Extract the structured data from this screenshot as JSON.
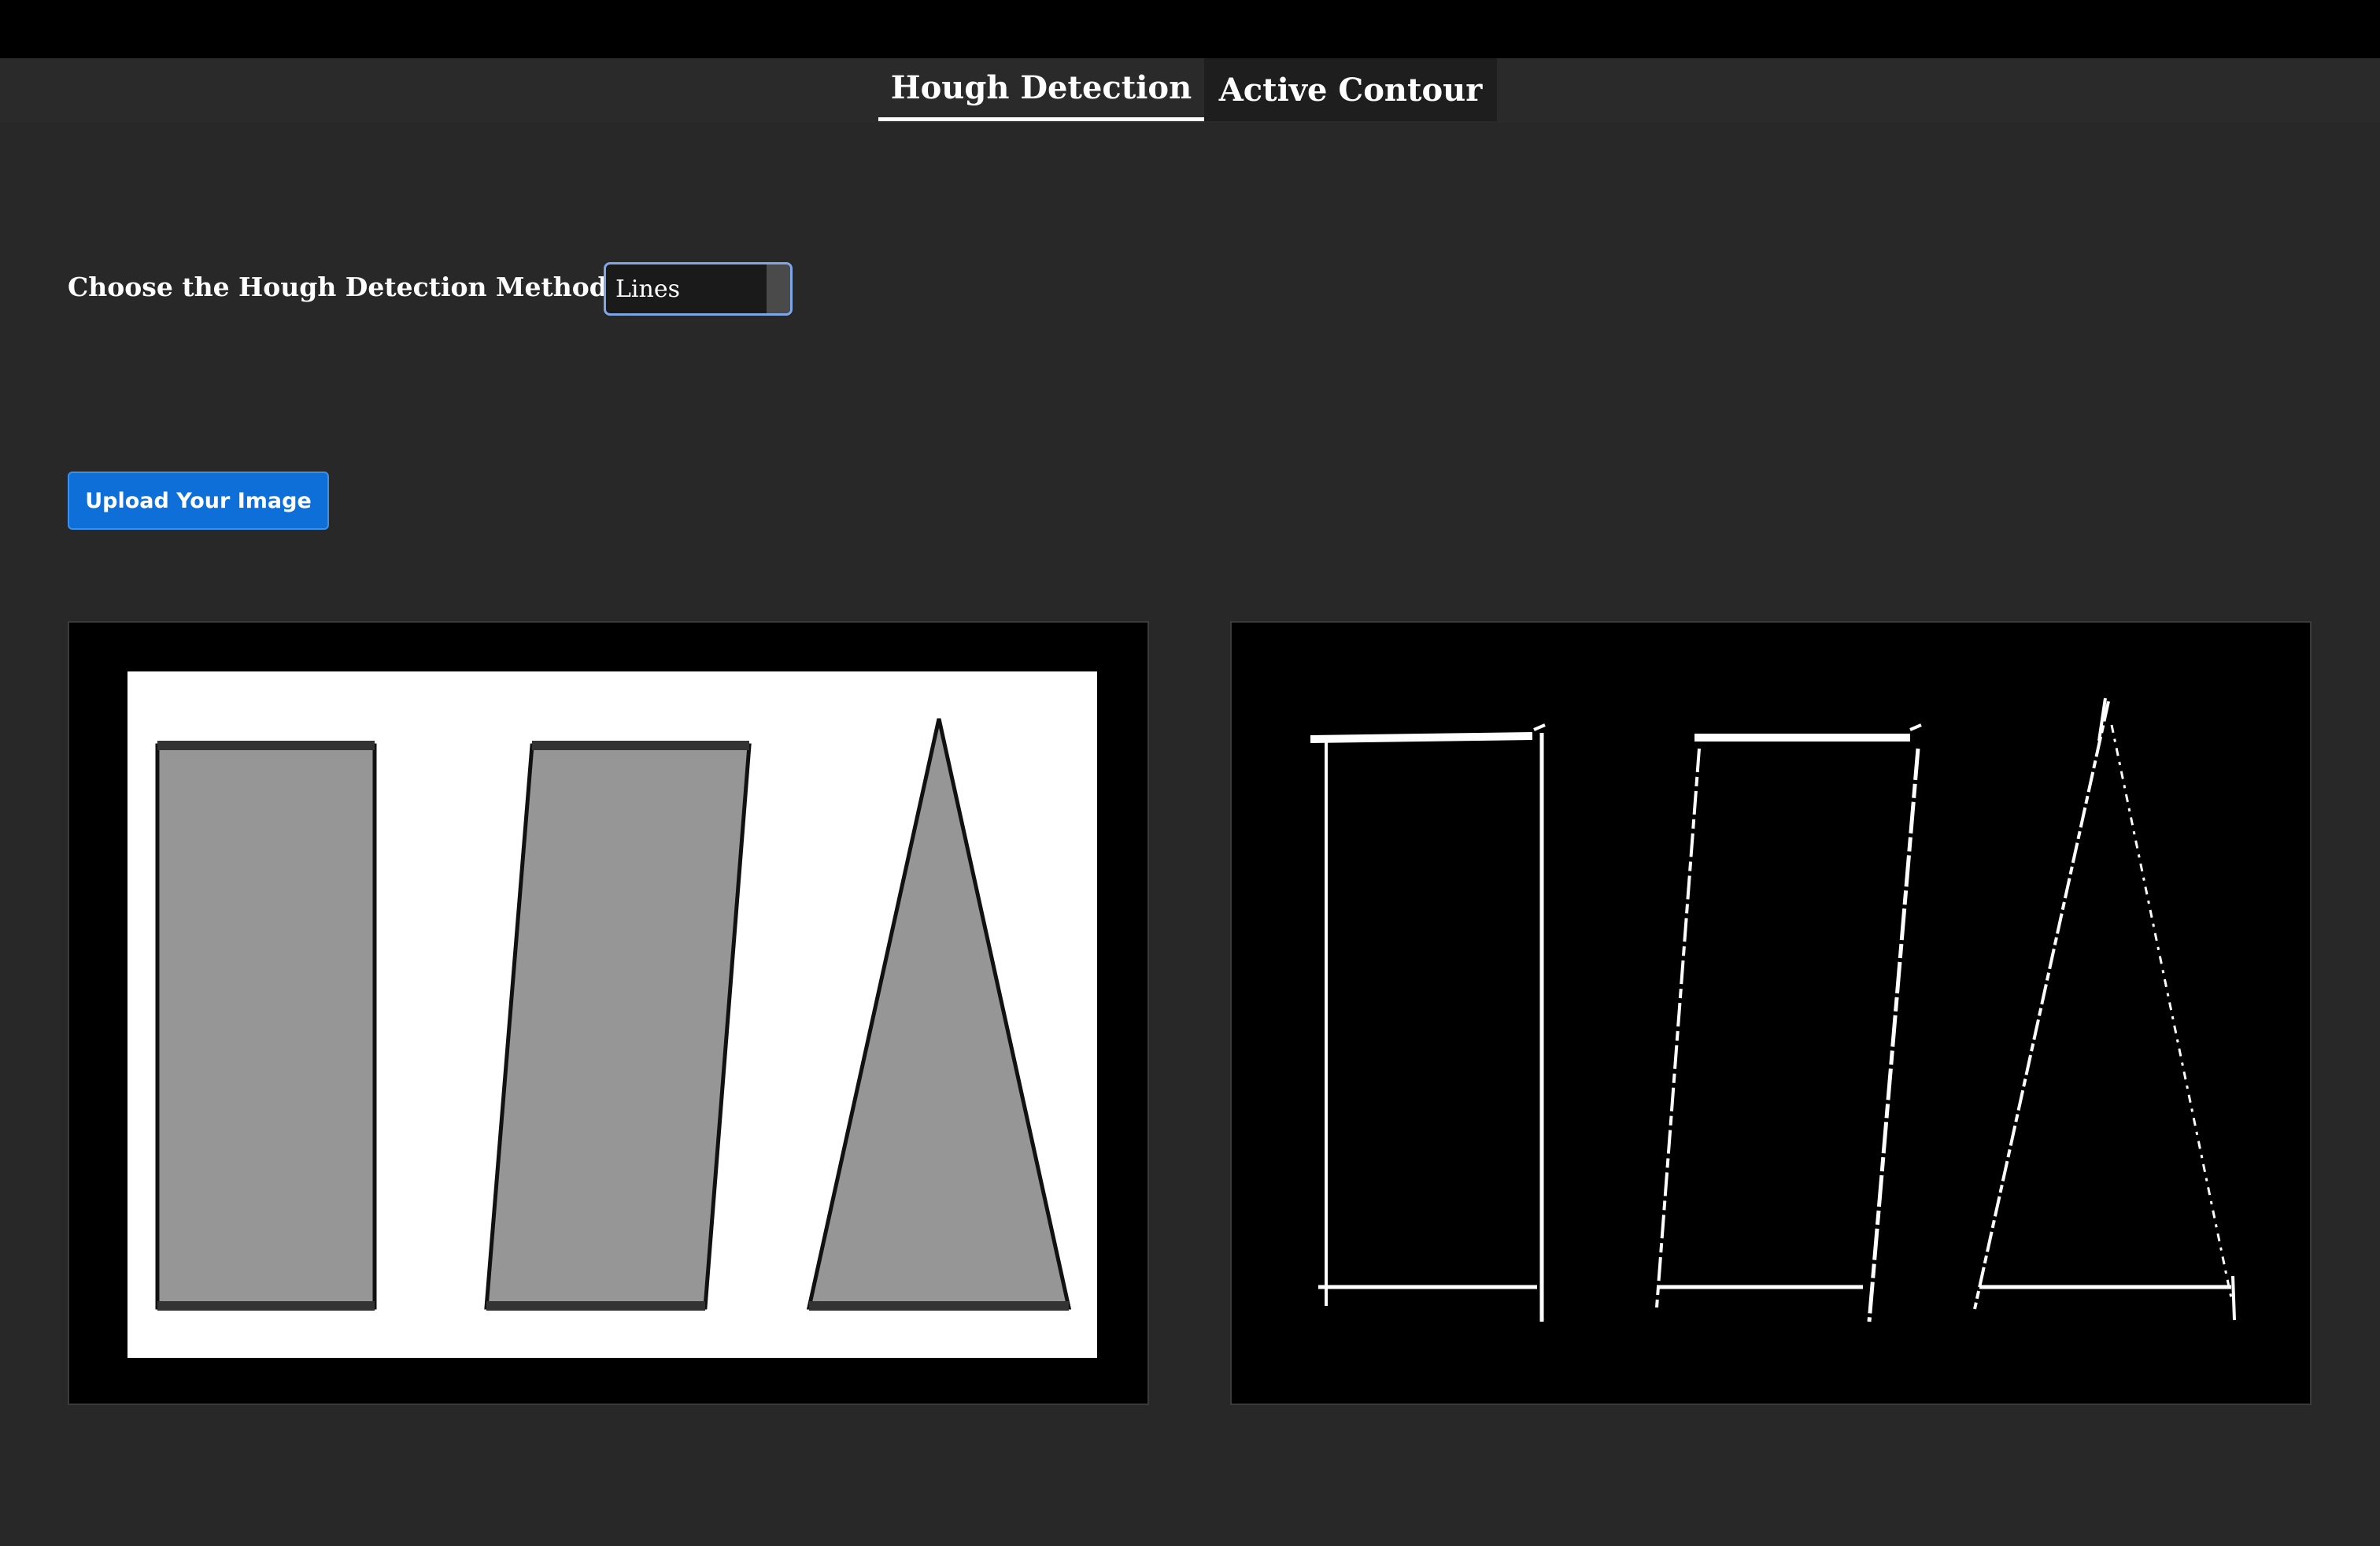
{
  "tabs": [
    {
      "label": "Hough Detection",
      "active": true
    },
    {
      "label": "Active Contour",
      "active": false
    }
  ],
  "method": {
    "label": "Choose the Hough Detection Method",
    "selected": "Lines"
  },
  "upload": {
    "label": "Upload Your Image"
  },
  "images": {
    "original": {
      "shapes": [
        "rectangle",
        "parallelogram",
        "triangle"
      ],
      "background": "#ffffff",
      "fill": "#969696"
    },
    "result": {
      "shapes": [
        "rectangle",
        "parallelogram",
        "triangle"
      ],
      "background": "#000000",
      "stroke": "#ffffff"
    }
  },
  "colors": {
    "accent": "#0f6fd9",
    "select_border": "#7fa7e8",
    "page_bg": "#282828"
  }
}
